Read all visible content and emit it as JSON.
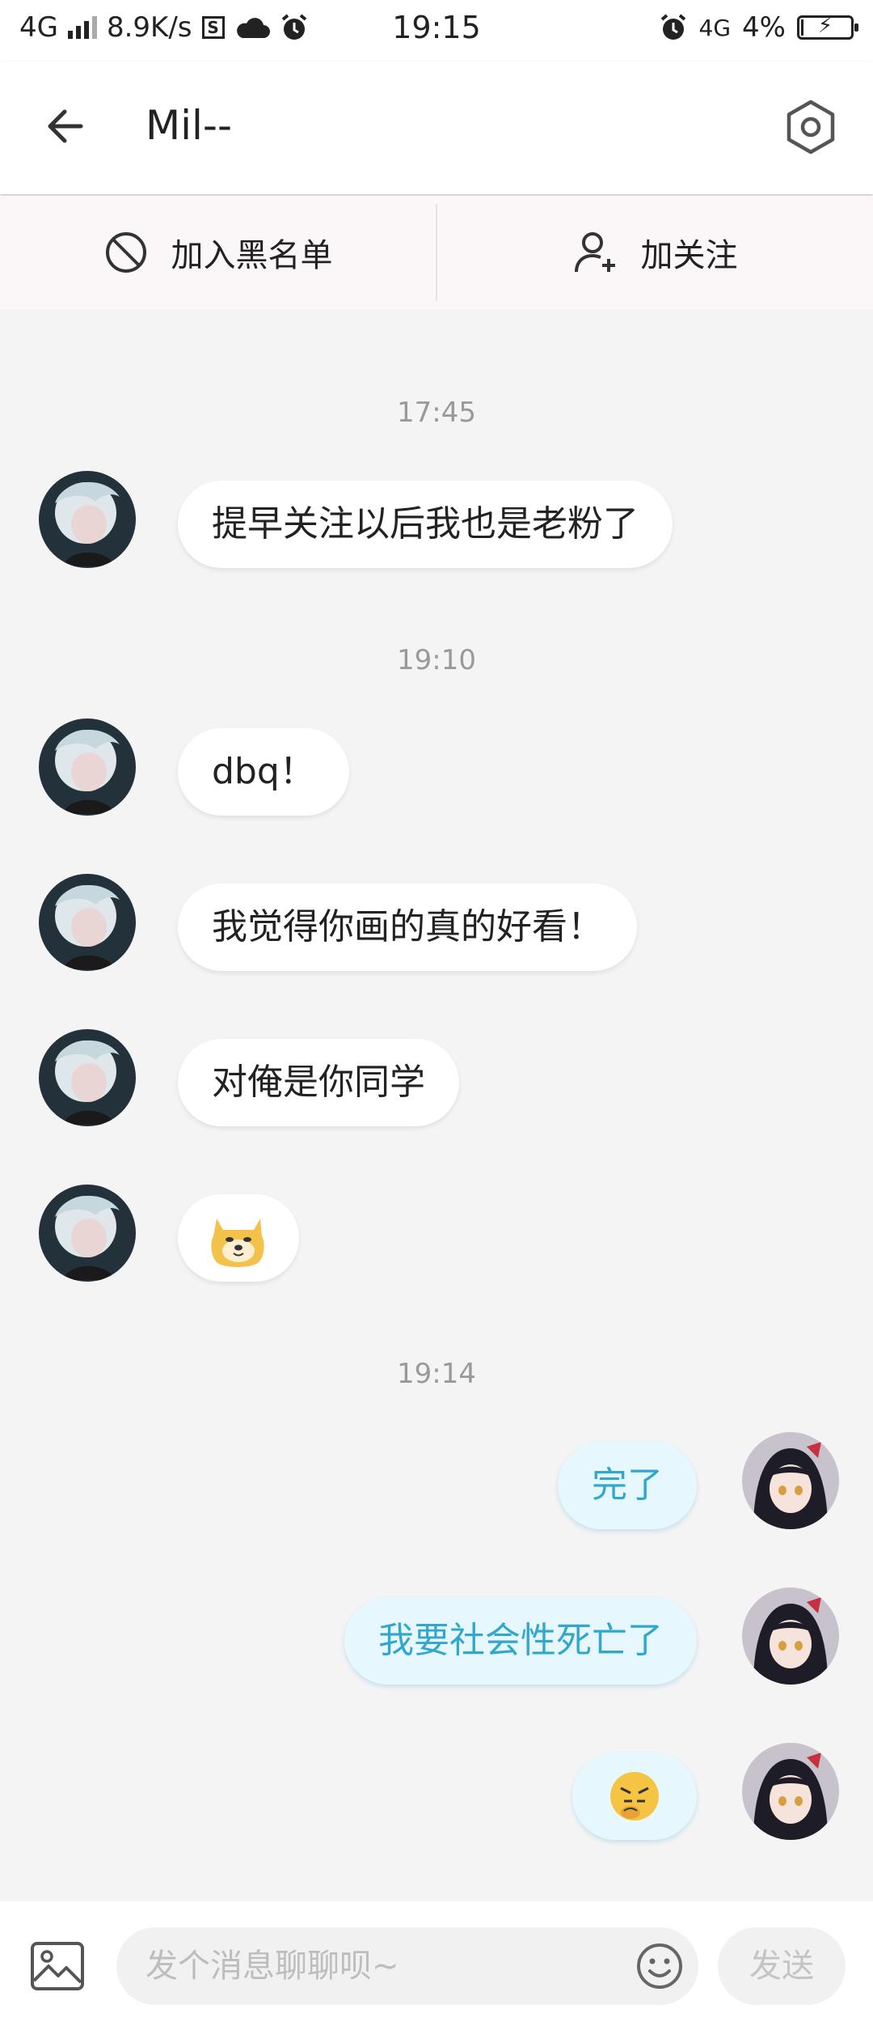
{
  "status_bar": {
    "network_left": "4G",
    "speed": "8.9K/s",
    "time": "19:15",
    "network_right": "4G",
    "battery": "4%",
    "icons": [
      "signal-icon",
      "s-app-icon",
      "cloud-icon",
      "alarm-icon",
      "alarm-icon",
      "battery-charging-icon"
    ]
  },
  "header": {
    "title": "Mil--",
    "back_icon": "arrow-left-icon",
    "settings_icon": "hexagon-gear-icon"
  },
  "actions": {
    "blacklist_label": "加入黑名单",
    "follow_label": "加关注"
  },
  "messages": {
    "ts1": "17:45",
    "m1": "提早关注以后我也是老粉了",
    "ts2": "19:10",
    "m2": "dbq！",
    "m3": "我觉得你画的真的好看！",
    "m4": "对俺是你同学",
    "m5_emoji": "doge-emoji",
    "ts3": "19:14",
    "m6": "完了",
    "m7": "我要社会性死亡了",
    "m8_emoji": "thinking-angry-emoji"
  },
  "input_bar": {
    "placeholder": "发个消息聊聊呗~",
    "send_label": "发送"
  },
  "colors": {
    "outgoing_bubble": "#e6f7fd",
    "outgoing_text": "#31a7cc",
    "chat_background": "#f4f4f4"
  }
}
